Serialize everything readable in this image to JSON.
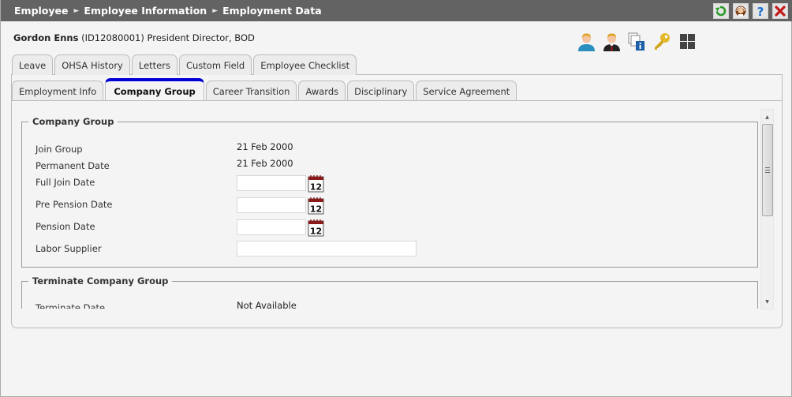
{
  "titlebar": {
    "breadcrumb": [
      "Employee",
      "Employee Information",
      "Employment Data"
    ],
    "separator": "►",
    "actions": [
      {
        "name": "refresh",
        "icon": "refresh-icon",
        "color": "#2a9a2a"
      },
      {
        "name": "support",
        "icon": "headset-icon",
        "color": "#7a3a14"
      },
      {
        "name": "help",
        "icon": "help-icon",
        "color": "#1a6fd0"
      },
      {
        "name": "close",
        "icon": "close-icon",
        "color": "#c41818"
      }
    ]
  },
  "employee": {
    "name": "Gordon Enns",
    "detail": "(ID12080001) President Director, BOD"
  },
  "employee_icons": [
    "user-icon",
    "manager-icon",
    "info-documents-icon",
    "key-icon",
    "grid-icon"
  ],
  "tabs_row1": [
    {
      "label": "Leave"
    },
    {
      "label": "OHSA History"
    },
    {
      "label": "Letters"
    },
    {
      "label": "Custom Field"
    },
    {
      "label": "Employee Checklist"
    }
  ],
  "tabs_row2": [
    {
      "label": "Employment Info",
      "active": false
    },
    {
      "label": "Company Group",
      "active": true
    },
    {
      "label": "Career Transition",
      "active": false
    },
    {
      "label": "Awards",
      "active": false
    },
    {
      "label": "Disciplinary",
      "active": false
    },
    {
      "label": "Service Agreement",
      "active": false
    }
  ],
  "company_group": {
    "legend": "Company Group",
    "join_group": {
      "label": "Join Group",
      "value": "21 Feb 2000"
    },
    "permanent_date": {
      "label": "Permanent Date",
      "value": "21 Feb 2000"
    },
    "full_join_date": {
      "label": "Full Join Date",
      "value": ""
    },
    "pre_pension_date": {
      "label": "Pre Pension Date",
      "value": ""
    },
    "pension_date": {
      "label": "Pension Date",
      "value": ""
    },
    "labor_supplier": {
      "label": "Labor Supplier",
      "value": ""
    },
    "calendar_day": "12"
  },
  "terminate_group": {
    "legend": "Terminate Company Group",
    "terminate_date": {
      "label": "Terminate Date",
      "value": "Not Available"
    }
  },
  "colors": {
    "titlebar": "#636363",
    "active_tab_accent": "#0000d6"
  }
}
